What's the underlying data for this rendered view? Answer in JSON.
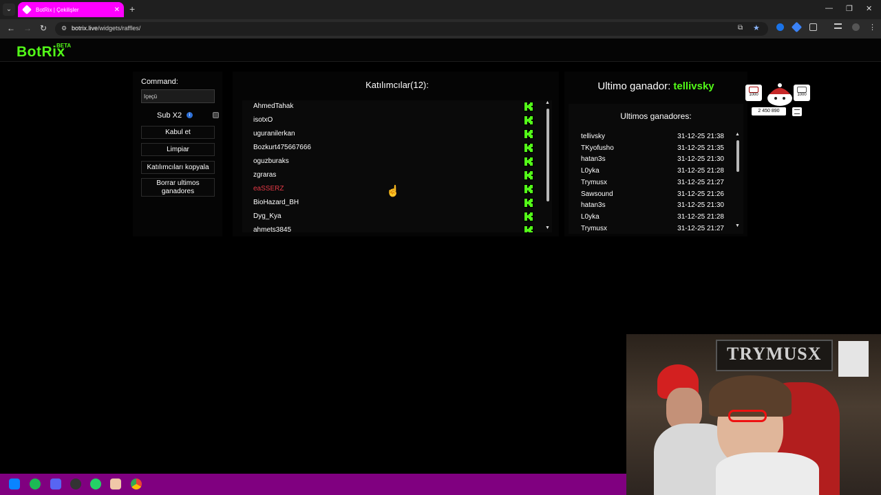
{
  "browser": {
    "tab_title": "BotRix | Çekilişler",
    "tab_close": "✕",
    "new_tab": "+",
    "url_host": "botrix.live",
    "url_path": "/widgets/raffles/",
    "win_minimize": "—",
    "win_maximize": "❐",
    "win_close": "✕"
  },
  "header": {
    "logo": "BotRix",
    "beta": "BETA"
  },
  "controls": {
    "command_label": "Command:",
    "command_value": "Içeçü",
    "sub_label": "Sub X2",
    "info_icon": "i",
    "accept_button": "Kabul et",
    "clear_button": "Limpiar",
    "copy_button": "Katılımcıları kopyala",
    "delete_button": "Borrar ultimos ganadores"
  },
  "participants": {
    "title": "Katılımcılar(12):",
    "items": [
      {
        "name": "AhmedTahak",
        "highlight": false
      },
      {
        "name": "isotxO",
        "highlight": false
      },
      {
        "name": "uguranilerkan",
        "highlight": false
      },
      {
        "name": "Bozkurt475667666",
        "highlight": false
      },
      {
        "name": "oguzburaks",
        "highlight": false
      },
      {
        "name": "zgraras",
        "highlight": false
      },
      {
        "name": "eaSSERZ",
        "highlight": true
      },
      {
        "name": "BioHazard_BH",
        "highlight": false
      },
      {
        "name": "Dyg_Kya",
        "highlight": false
      },
      {
        "name": "ahmets3845",
        "highlight": false
      }
    ]
  },
  "winners": {
    "last_label": "Ultimo ganador:",
    "last_name": "tellivsky",
    "list_title": "Ultimos ganadores:",
    "items": [
      {
        "name": "tellivsky",
        "date": "31-12-25 21:38"
      },
      {
        "name": "TKyofusho",
        "date": "31-12-25 21:35"
      },
      {
        "name": "hatan3s",
        "date": "31-12-25 21:30"
      },
      {
        "name": "L0yka",
        "date": "31-12-25 21:28"
      },
      {
        "name": "Trymusx",
        "date": "31-12-25 21:27"
      },
      {
        "name": "Sawsound",
        "date": "31-12-25 21:26"
      },
      {
        "name": "hatan3s",
        "date": "31-12-25 21:30"
      },
      {
        "name": "L0yka",
        "date": "31-12-25 21:28"
      },
      {
        "name": "Trymusx",
        "date": "31-12-25 21:27"
      }
    ]
  },
  "widget": {
    "badge_left": "1000",
    "badge_right": "1000",
    "counter": "2 450 890"
  },
  "webcam": {
    "sign": "TRYMUSX"
  },
  "colors": {
    "accent": "#53fc18",
    "taskbar": "#800080",
    "tab": "#ff00ff",
    "highlight": "#e63946"
  }
}
